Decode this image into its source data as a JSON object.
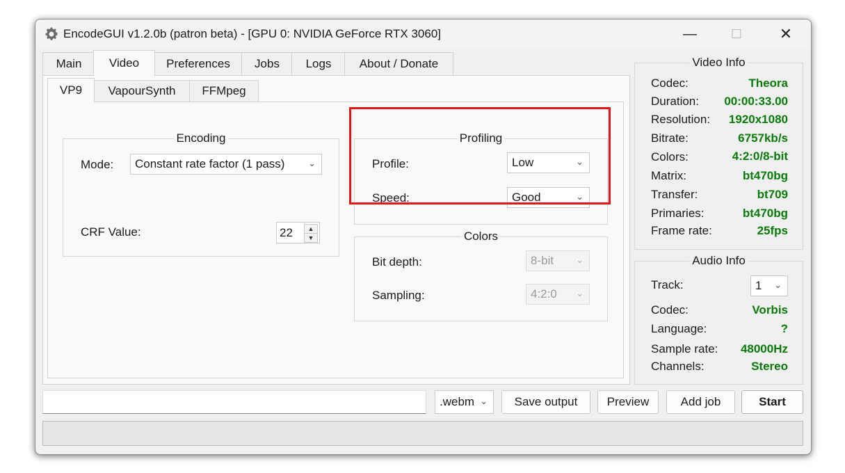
{
  "window": {
    "title": "EncodeGUI v1.2.0b (patron beta) - [GPU 0: NVIDIA GeForce RTX 3060]",
    "controls": {
      "minimize": "—",
      "maximize": "☐",
      "close": "✕"
    }
  },
  "tabs": [
    "Main",
    "Video",
    "Preferences",
    "Jobs",
    "Logs",
    "About / Donate"
  ],
  "active_tab": "Video",
  "subtabs": [
    "VP9",
    "VapourSynth",
    "FFMpeg"
  ],
  "active_subtab": "VP9",
  "encoding": {
    "title": "Encoding",
    "mode_label": "Mode:",
    "mode_value": "Constant rate factor (1 pass)",
    "crf_label": "CRF Value:",
    "crf_value": "22"
  },
  "profiling": {
    "title": "Profiling",
    "profile_label": "Profile:",
    "profile_value": "Low",
    "speed_label": "Speed:",
    "speed_value": "Good"
  },
  "colors": {
    "title": "Colors",
    "bitdepth_label": "Bit depth:",
    "bitdepth_value": "8-bit",
    "sampling_label": "Sampling:",
    "sampling_value": "4:2:0"
  },
  "video_info": {
    "title": "Video Info",
    "rows": [
      {
        "label": "Codec:",
        "value": "Theora"
      },
      {
        "label": "Duration:",
        "value": "00:00:33.00"
      },
      {
        "label": "Resolution:",
        "value": "1920x1080"
      },
      {
        "label": "Bitrate:",
        "value": "6757kb/s"
      },
      {
        "label": "Colors:",
        "value": "4:2:0/8-bit"
      },
      {
        "label": "Matrix:",
        "value": "bt470bg"
      },
      {
        "label": "Transfer:",
        "value": "bt709"
      },
      {
        "label": "Primaries:",
        "value": "bt470bg"
      },
      {
        "label": "Frame rate:",
        "value": "25fps"
      }
    ]
  },
  "audio_info": {
    "title": "Audio Info",
    "track_label": "Track:",
    "track_value": "1",
    "rows": [
      {
        "label": "Codec:",
        "value": "Vorbis"
      },
      {
        "label": "Language:",
        "value": "?"
      },
      {
        "label": "Sample rate:",
        "value": "48000Hz"
      },
      {
        "label": "Channels:",
        "value": "Stereo"
      }
    ]
  },
  "bottom": {
    "output_path": "",
    "container": ".webm",
    "save_output": "Save output",
    "preview": "Preview",
    "add_job": "Add job",
    "start": "Start"
  },
  "progress": 0,
  "colors_theme": {
    "value_green": "#0a7a0a",
    "highlight_red": "#e0161b"
  }
}
